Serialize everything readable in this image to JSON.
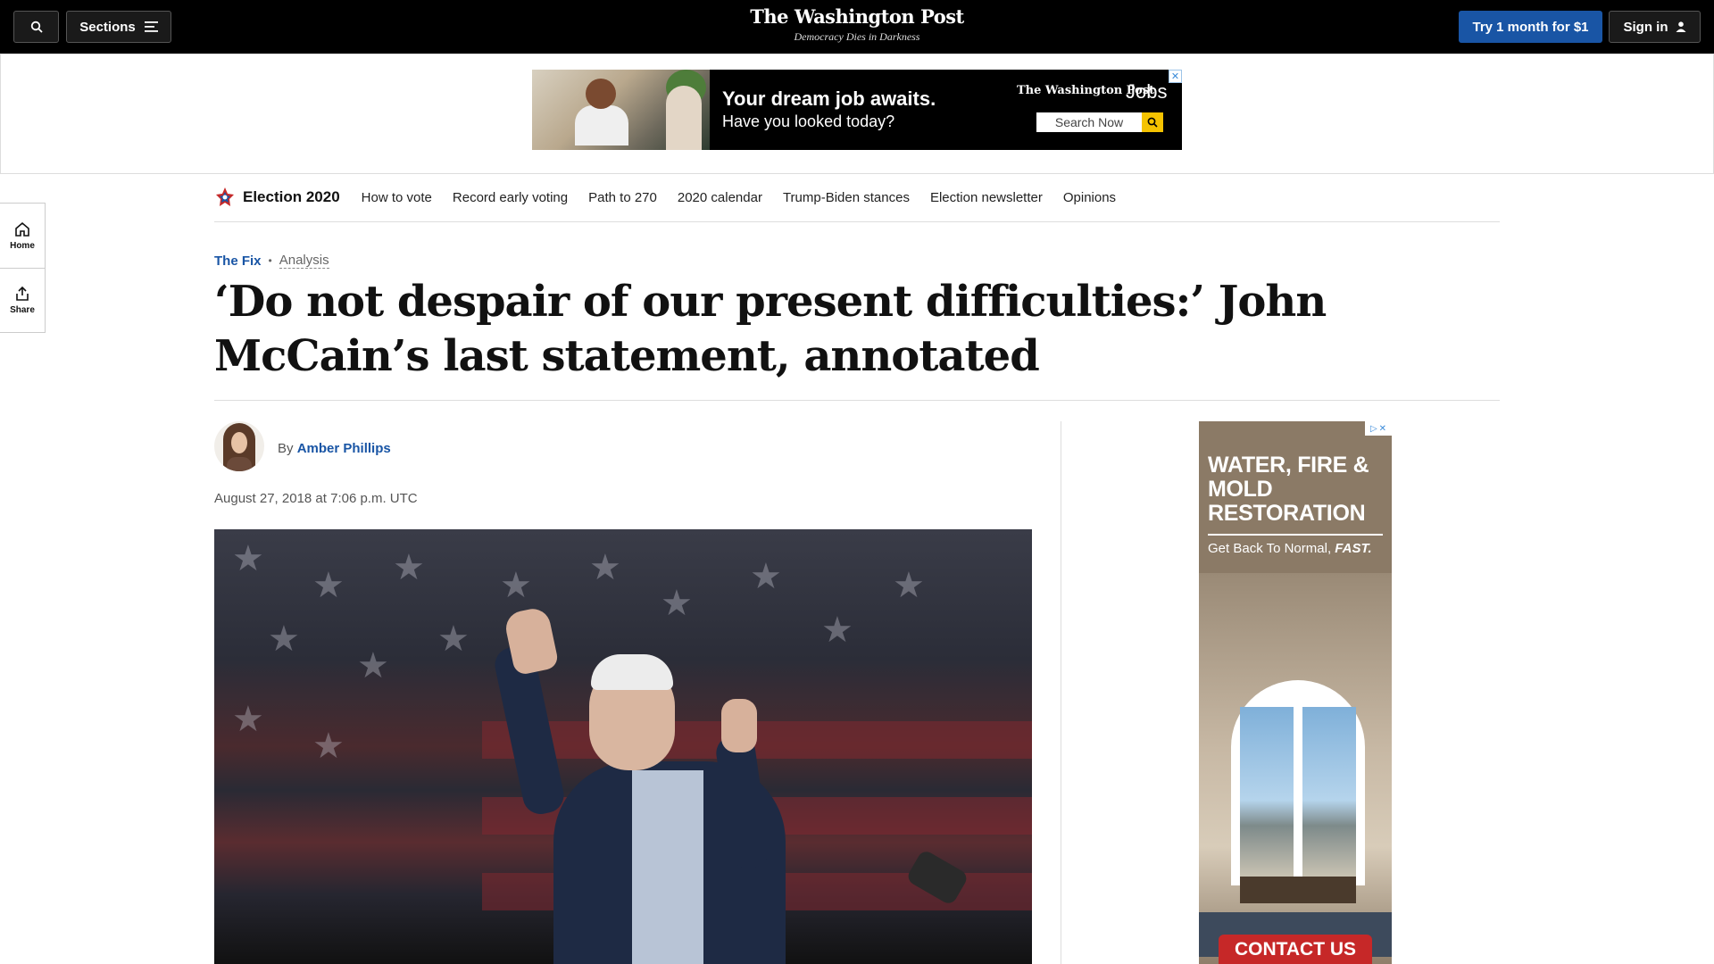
{
  "topbar": {
    "sections_label": "Sections",
    "logo_title": "The Washington Post",
    "logo_tagline": "Democracy Dies in Darkness",
    "try_label": "Try 1 month for $1",
    "signin_label": "Sign in"
  },
  "ad_top": {
    "headline": "Your dream job awaits.",
    "subline": "Have you looked today?",
    "brand": "The Washington Post",
    "brand_suffix": "Jobs",
    "search_label": "Search Now",
    "close": "✕"
  },
  "election_nav": {
    "title": "Election 2020",
    "links": [
      "How to vote",
      "Record early voting",
      "Path to 270",
      "2020 calendar",
      "Trump-Biden stances",
      "Election newsletter",
      "Opinions"
    ]
  },
  "rail": {
    "home_label": "Home",
    "share_label": "Share"
  },
  "article": {
    "section": "The Fix",
    "separator": "•",
    "label": "Analysis",
    "headline": "‘Do not despair of our present difficulties:’ John McCain’s last statement, annotated",
    "byline_prefix": "By",
    "author": "Amber Phillips",
    "date": "August 27, 2018 at 7:06 p.m. UTC"
  },
  "ad_side": {
    "headline": "WATER, FIRE & MOLD RESTORATION",
    "tagline_start": "Get Back To Normal,",
    "tagline_emph": "FAST.",
    "cta": "CONTACT US",
    "adchoices": "▷",
    "close": "✕"
  },
  "colors": {
    "accent": "#1955a5",
    "topbar": "#000000",
    "cta_red": "#c62828"
  },
  "icons": [
    "search-icon",
    "menu-icon",
    "user-icon",
    "home-icon",
    "share-icon",
    "election-star-icon",
    "search-magnifier-icon"
  ]
}
